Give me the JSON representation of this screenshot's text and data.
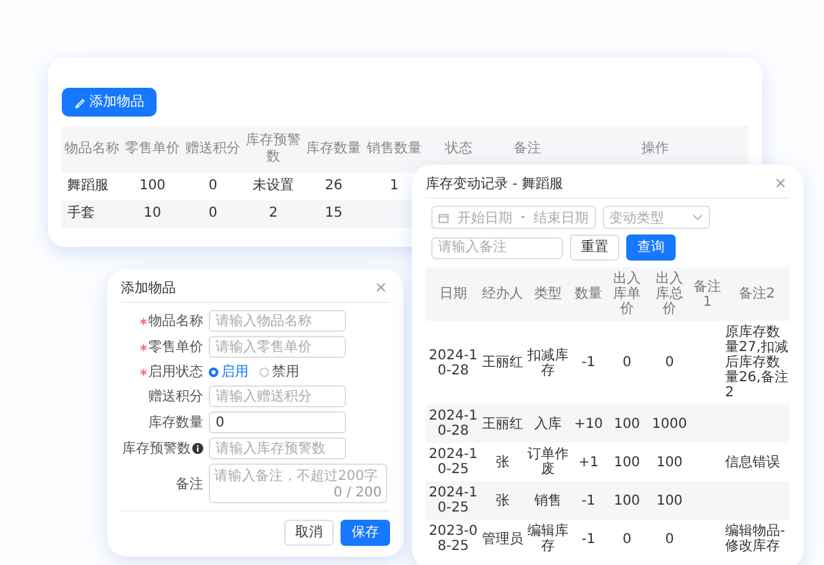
{
  "product_list": {
    "add_button": "添加物品",
    "columns": [
      "物品名称",
      "零售单价",
      "赠送积分",
      "库存预警数",
      "库存数量",
      "销售数量",
      "状态",
      "备注",
      "操作"
    ],
    "rows": [
      {
        "name": "舞蹈服",
        "retail_price": "100",
        "points": "0",
        "stock_warning": "未设置",
        "stock": "26",
        "sales": "1"
      },
      {
        "name": "手套",
        "retail_price": "10",
        "points": "0",
        "stock_warning": "2",
        "stock": "15"
      }
    ]
  },
  "add_dialog": {
    "title": "添加物品",
    "close": "×",
    "fields": [
      {
        "kind": "input",
        "label": "物品名称",
        "required": true,
        "info": false,
        "placeholder": "请输入物品名称"
      },
      {
        "kind": "input",
        "label": "零售单价",
        "required": true,
        "info": false,
        "placeholder": "请输入零售单价"
      },
      {
        "kind": "radio",
        "label": "启用状态",
        "required": true,
        "info": false,
        "options": [
          {
            "label": "启用",
            "selected": true
          },
          {
            "label": "禁用",
            "selected": false
          }
        ]
      },
      {
        "kind": "input",
        "label": "赠送积分",
        "required": false,
        "info": false,
        "placeholder": "请输入赠送积分"
      },
      {
        "kind": "input",
        "label": "库存数量",
        "required": false,
        "info": false,
        "value": "0"
      },
      {
        "kind": "input",
        "label": "库存预警数",
        "required": false,
        "info": true,
        "placeholder": "请输入库存预警数"
      },
      {
        "kind": "textarea",
        "label": "备注",
        "required": false,
        "info": false,
        "placeholder": "请输入备注，不超过200字",
        "counter": "0 / 200"
      }
    ],
    "buttons": [
      {
        "label": "取消",
        "primary": false
      },
      {
        "label": "保存",
        "primary": true
      }
    ]
  },
  "stock_dialog": {
    "title": "库存变动记录 - 舞蹈服",
    "close": "×",
    "date_range": {
      "start_placeholder": "开始日期",
      "separator": "-",
      "end_placeholder": "结束日期"
    },
    "type_select": {
      "placeholder": "变动类型"
    },
    "remark_search": {
      "placeholder": "请输入备注"
    },
    "buttons": [
      {
        "label": "重置",
        "primary": false
      },
      {
        "label": "查询",
        "primary": true
      }
    ],
    "columns": [
      "日期",
      "经办人",
      "类型",
      "数量",
      "出入库单价",
      "出入库总价",
      "备注1",
      "备注2"
    ],
    "rows": [
      {
        "date": "2024-10-28",
        "operator": "王丽红",
        "type": "扣减库存",
        "quantity": "-1",
        "unit_price": "0",
        "total_price": "0",
        "remark_2": "原库存数量27,扣减后库存数量26,备注2"
      },
      {
        "date": "2024-10-28",
        "operator": "王丽红",
        "type": "入库",
        "quantity": "+10",
        "unit_price": "100",
        "total_price": "1000"
      },
      {
        "date": "2024-10-25",
        "operator": "张",
        "type": "订单作废",
        "quantity": "+1",
        "unit_price": "100",
        "total_price": "100",
        "remark_2": "信息错误"
      },
      {
        "date": "2024-10-25",
        "operator": "张",
        "type": "销售",
        "quantity": "-1",
        "unit_price": "100",
        "total_price": "100"
      },
      {
        "date": "2023-08-25",
        "operator": "管理员",
        "type": "编辑库存",
        "quantity": "-1",
        "unit_price": "0",
        "total_price": "0",
        "remark_2": "编辑物品-修改库存"
      }
    ]
  }
}
